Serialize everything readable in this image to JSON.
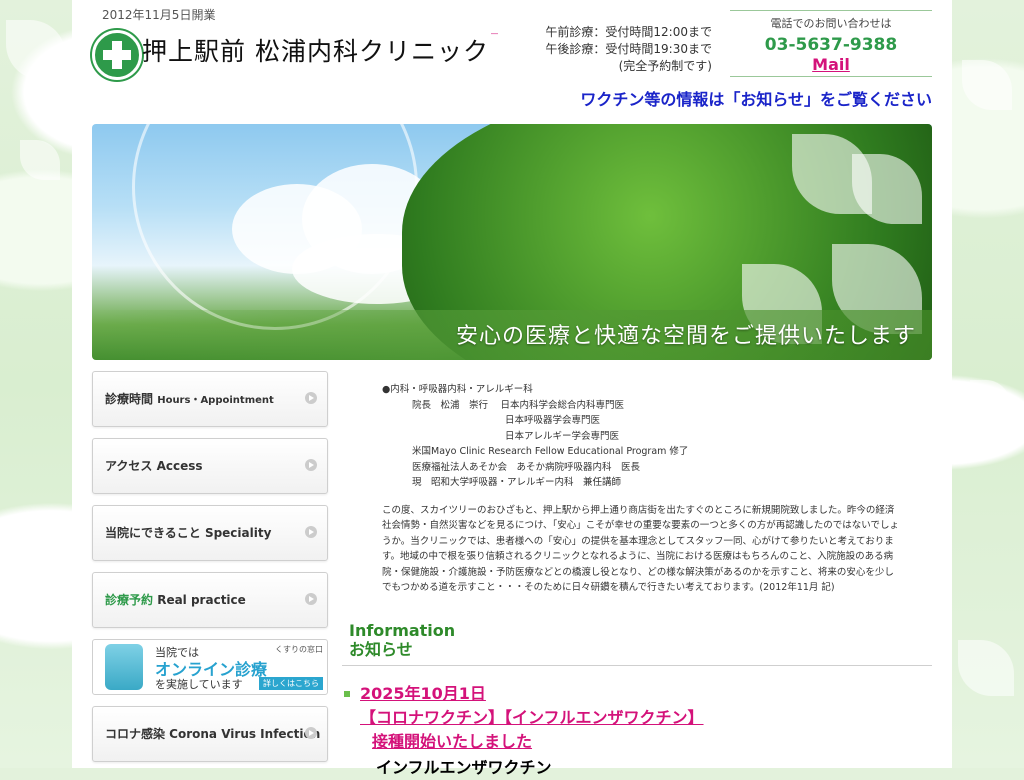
{
  "header": {
    "established": "2012年11月5日開業",
    "clinic_name": "押上駅前 松浦内科クリニック",
    "hours_line1": "午前診療：受付時間12:00まで",
    "hours_line2": "午後診療：受付時間19:30まで",
    "hours_line3": "(完全予約制です)",
    "contact_label": "電話でのお問い合わせは",
    "phone": "03-5637-9388",
    "mail_label": "Mail",
    "vaccine_notice": "ワクチン等の情報は「お知らせ」をご覧ください"
  },
  "hero": {
    "tagline": "安心の医療と快適な空間をご提供いたします"
  },
  "sidebar": {
    "items": [
      {
        "label": "診療時間",
        "label_en": "Hours・Appointment"
      },
      {
        "label": "アクセス Access"
      },
      {
        "label": "当院にできること Speciality"
      },
      {
        "label": "診療予約",
        "label_en": "Real practice"
      },
      {
        "label": "コロナ感染 Corona Virus Infection"
      }
    ],
    "online_banner": {
      "line1": "当院では",
      "line2": "オンライン診療",
      "line3": "を実施しています",
      "tag": "くすりの窓口",
      "more": "詳しくはこちら"
    }
  },
  "profile": {
    "department": "●内科・呼吸器内科・アレルギー科",
    "director_line": "院長　松浦　崇行　 日本内科学会総合内科専門医",
    "cert2": "日本呼吸器学会専門医",
    "cert3": "日本アレルギー学会専門医",
    "career1": "米国Mayo Clinic Research Fellow Educational Program 修了",
    "career2": "医療福祉法人あそか会　あそか病院呼吸器内科　医長",
    "career3": "現　昭和大学呼吸器・アレルギー内科　兼任講師",
    "greeting": "この度、スカイツリーのおひざもと、押上駅から押上通り商店街を出たすぐのところに新規開院致しました。昨今の経済社会情勢・自然災害などを見るにつけ、「安心」こそが幸せの重要な要素の一つと多くの方が再認識したのではないでしょうか。当クリニックでは、患者様への「安心」の提供を基本理念としてスタッフ一同、心がけて参りたいと考えております。地域の中で根を張り信頼されるクリニックとなれるように、当院における医療はもちろんのこと、入院施設のある病院・保健施設・介護施設・予防医療などとの橋渡し役となり、どの様な解決策があるのかを示すこと、将来の安心を少しでもつかめる道を示すこと・・・そのために日々研鑽を積んで行きたい考えております。(2012年11月 記)"
  },
  "information": {
    "title_en": "Information",
    "title_ja": "お知らせ",
    "news": [
      {
        "date": "2025年10月1日",
        "headline1": "【コロナワクチン】【インフルエンザワクチン】",
        "headline2": "接種開始いたしました",
        "sub": "インフルエンザワクチン"
      }
    ]
  },
  "colors": {
    "brand_green": "#2e9a4a",
    "link_magenta": "#d4127a",
    "notice_blue": "#1a24c9"
  }
}
